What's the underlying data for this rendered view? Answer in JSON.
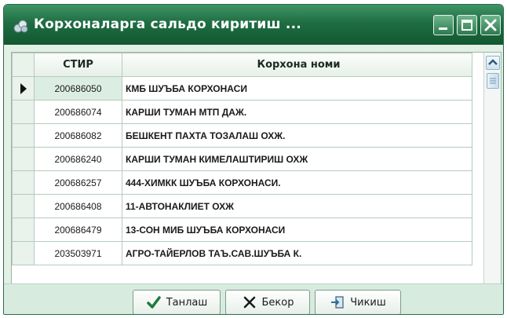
{
  "window": {
    "title": "Корхоналарга сальдо киритиш ..."
  },
  "titlebar_buttons": [
    "minimize-icon",
    "maximize-icon",
    "close-icon"
  ],
  "grid": {
    "columns": [
      "СТИР",
      "Корхона номи"
    ],
    "selected_row": 0,
    "rows": [
      {
        "stir": "200686050",
        "name": "КМБ ШУЪБА КОРХОНАСИ"
      },
      {
        "stir": "200686074",
        "name": "КАРШИ ТУМАН МТП ДАЖ."
      },
      {
        "stir": "200686082",
        "name": "БЕШКЕНТ ПАХТА ТОЗАЛАШ ОХЖ."
      },
      {
        "stir": "200686240",
        "name": "КАРШИ ТУМАН КИМЕЛАШТИРИШ ОХЖ"
      },
      {
        "stir": "200686257",
        "name": "444-ХИМКК ШУЪБА КОРХОНАСИ."
      },
      {
        "stir": "200686408",
        "name": "11-АВТОНАКЛИЕТ ОХЖ"
      },
      {
        "stir": "200686479",
        "name": "13-СОН МИБ ШУЪБА КОРХОНАСИ"
      },
      {
        "stir": "203503971",
        "name": "АГРО-ТАЙЕРЛОВ ТАЪ.САВ.ШУЪБА К."
      }
    ]
  },
  "buttons": {
    "select": {
      "label": "Танлаш",
      "icon": "checkmark-icon"
    },
    "cancel": {
      "label": "Бекор",
      "icon": "x-icon"
    },
    "exit": {
      "label": "Чикиш",
      "icon": "exit-door-icon"
    }
  },
  "colors": {
    "titlebar": "#1f6d43",
    "window_bg": "#e2f0e6",
    "selected_cell": "#dceee3"
  }
}
